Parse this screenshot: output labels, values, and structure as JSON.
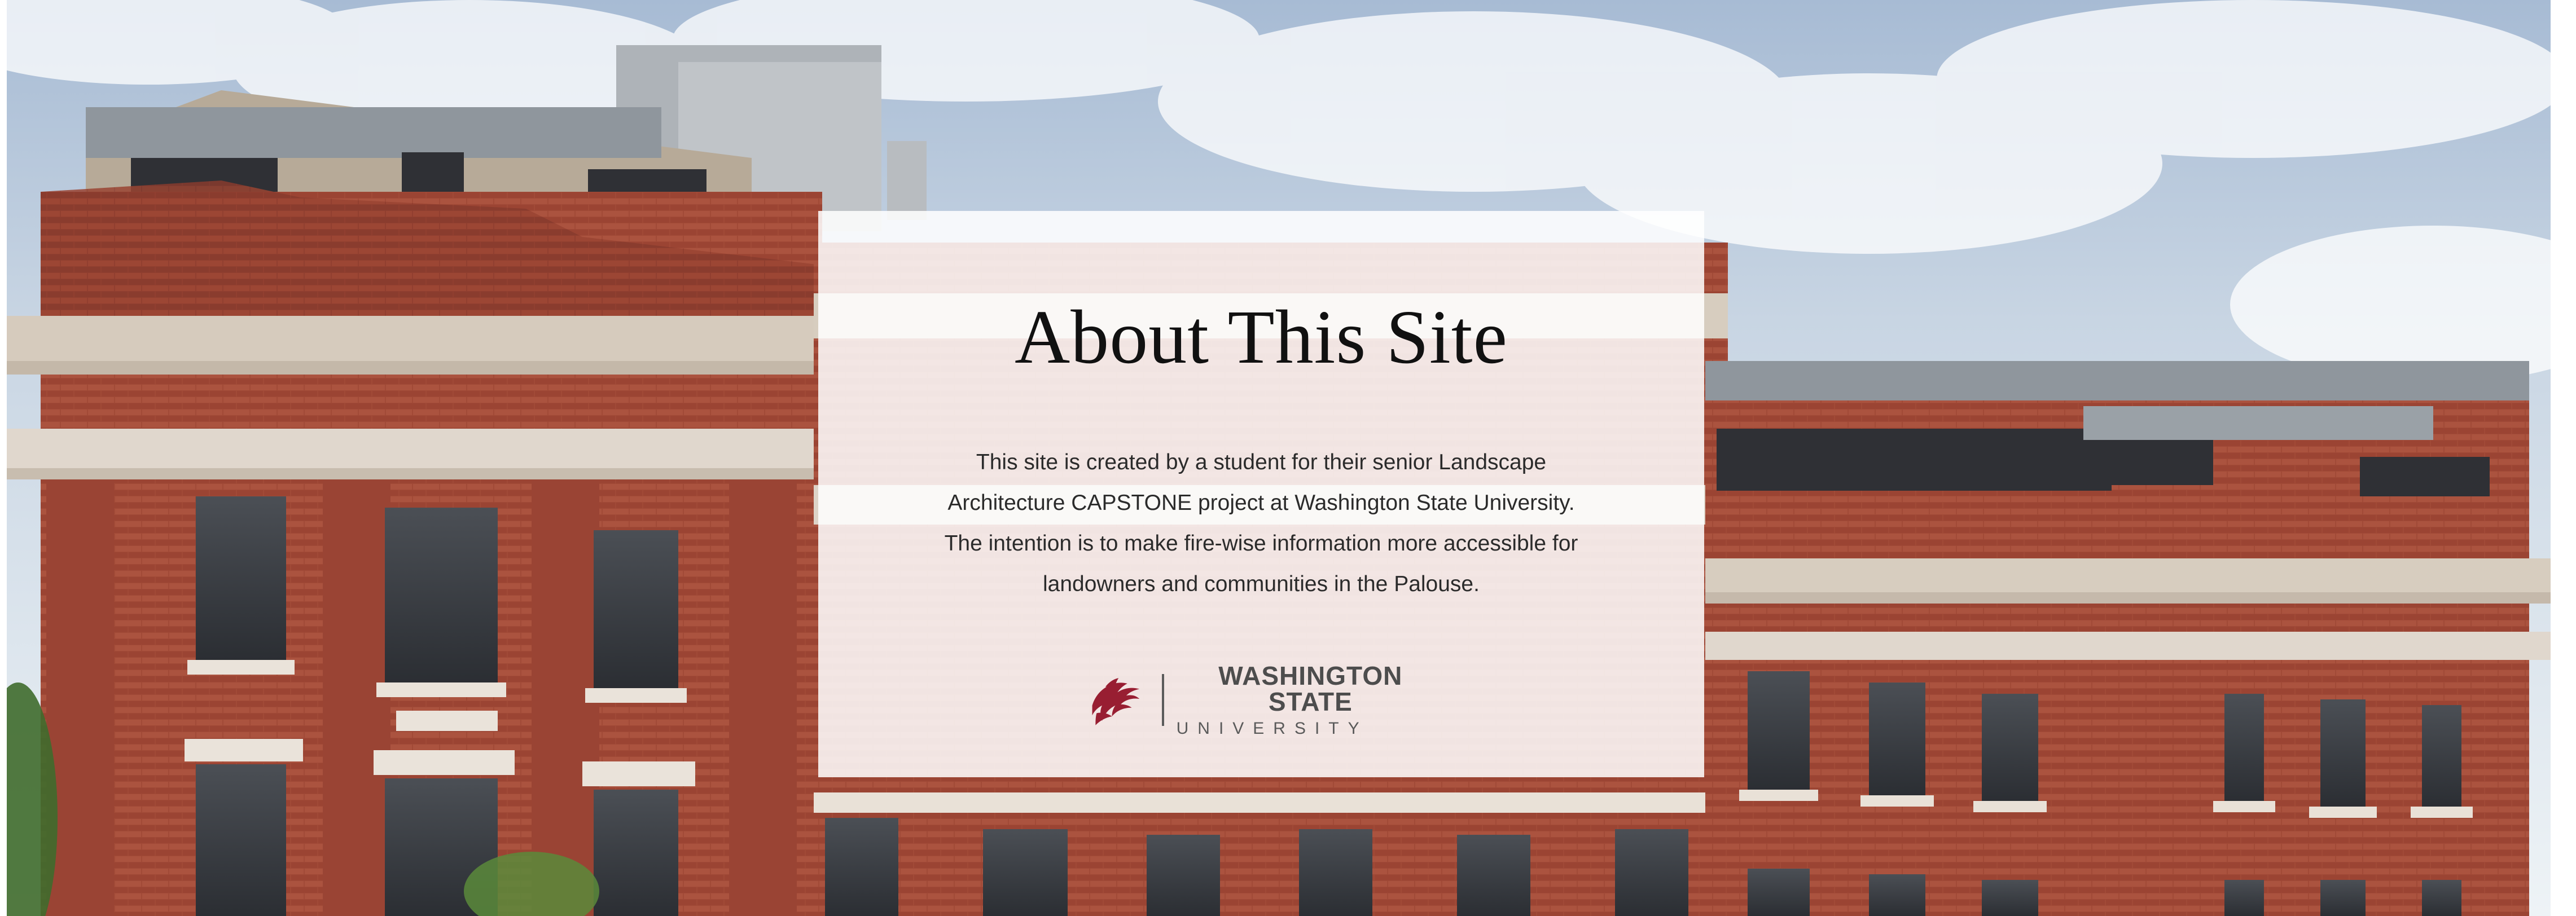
{
  "card": {
    "title": "About This Site",
    "body": "This site is created by a student for their senior Landscape Architecture CAPSTONE project at Washington State University.  The intention is to make fire-wise information more accessible for landowners and communities in the Palouse."
  },
  "logo": {
    "icon": "cougar-head-icon",
    "line1": "WASHINGTON STATE",
    "line2": "UNIVERSITY",
    "color": "#981e32"
  },
  "colors": {
    "brick": "#9d4634",
    "card_bg": "#ffffff",
    "title_text": "#111111",
    "body_text": "#2b2b2b"
  }
}
